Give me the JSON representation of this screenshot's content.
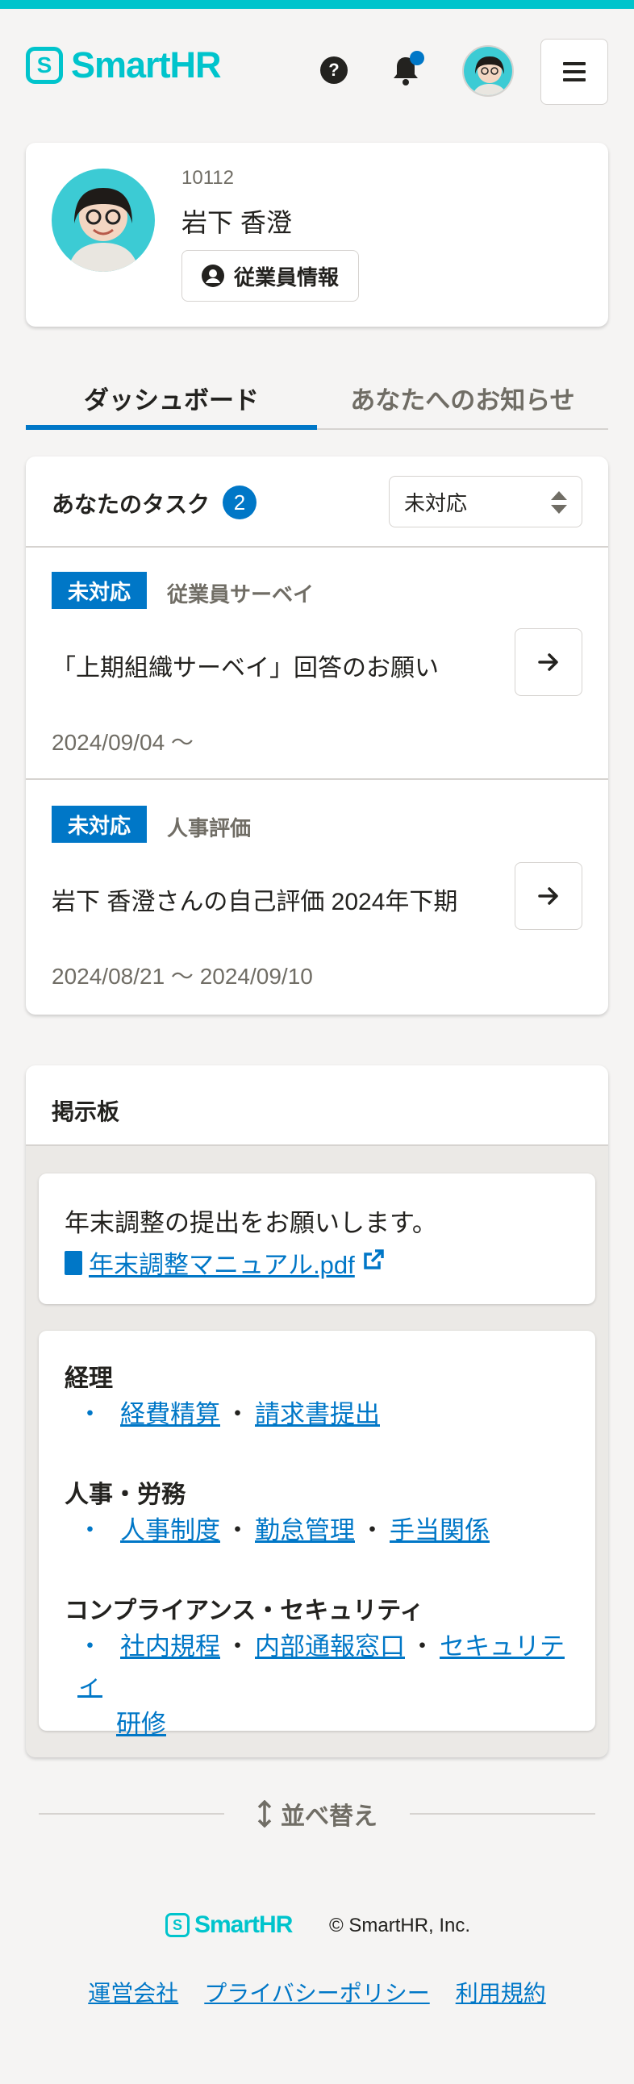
{
  "header": {
    "logo_text": "SmartHR",
    "logo_mark": "S",
    "help_icon": "question-circle-icon",
    "notification_icon": "bell-icon",
    "menu_icon": "hamburger-icon"
  },
  "profile": {
    "employee_no": "10112",
    "name": "岩下 香澄",
    "employee_info_button": "従業員情報"
  },
  "tabs": [
    {
      "label": "ダッシュボード",
      "active": true
    },
    {
      "label": "あなたへのお知らせ",
      "active": false
    }
  ],
  "tasks": {
    "title": "あなたのタスク",
    "count": "2",
    "filter_selected": "未対応",
    "items": [
      {
        "status": "未対応",
        "category": "従業員サーベイ",
        "title": "「上期組織サーベイ」回答のお願い",
        "date": "2024/09/04 〜"
      },
      {
        "status": "未対応",
        "category": "人事評価",
        "title": "岩下 香澄さんの自己評価 2024年下期",
        "date": "2024/08/21 〜 2024/09/10"
      }
    ]
  },
  "bulletin": {
    "title": "掲示板",
    "post1": {
      "text": "年末調整の提出をお願いします。",
      "link": "年末調整マニュアル.pdf"
    },
    "sections": [
      {
        "title": "経理",
        "links": [
          "経費精算",
          "請求書提出"
        ]
      },
      {
        "title": "人事・労務",
        "links": [
          "人事制度",
          "勤怠管理",
          "手当関係"
        ]
      },
      {
        "title": "コンプライアンス・セキュリティ",
        "links": [
          "社内規程",
          "内部通報窓口",
          "セキュリティ",
          "研修"
        ]
      }
    ],
    "separator": "・",
    "bullet": "・"
  },
  "sort_label": "並べ替え",
  "footer": {
    "logo_text": "SmartHR",
    "copyright": "© SmartHR, Inc.",
    "links": [
      "運営会社",
      "プライバシーポリシー",
      "利用規約"
    ]
  },
  "colors": {
    "accent": "#00c4cc",
    "primary": "#0077c7",
    "text": "#23221f",
    "muted": "#706d65",
    "background": "#f5f4f3"
  }
}
